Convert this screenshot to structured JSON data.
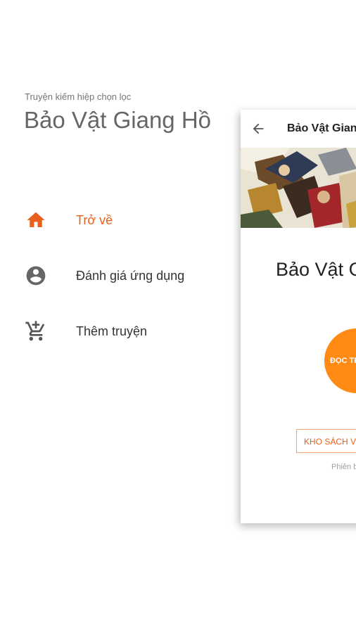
{
  "drawer": {
    "subtitle": "Truyện kiếm hiệp chọn lọc",
    "title": "Bảo Vật Giang Hồ",
    "items": [
      {
        "label": "Trở về",
        "icon": "home-icon",
        "active": true
      },
      {
        "label": "Đánh giá ứng dụng",
        "icon": "account-circle-icon",
        "active": false
      },
      {
        "label": "Thêm truyện",
        "icon": "add-cart-icon",
        "active": false
      }
    ]
  },
  "preview": {
    "appbar_title": "Bảo Vật Giang Hồ",
    "book_title": "Bảo Vật Giang Hồ",
    "read_button": "ĐỌC TRUYỆN",
    "library_button": "KHO SÁCH VIP",
    "version": "Phiên bản"
  },
  "colors": {
    "accent": "#e8601c",
    "button": "#ff8a14",
    "text": "#333333",
    "title": "#666666"
  }
}
